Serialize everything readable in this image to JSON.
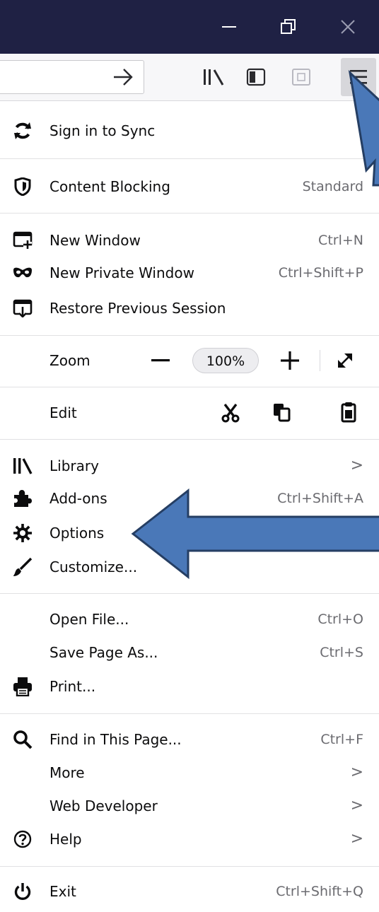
{
  "window": {
    "controls": [
      "minimize-icon",
      "restore-icon",
      "close-icon"
    ]
  },
  "toolbar": {
    "url_forward_icon": "arrow-right-icon",
    "icons": [
      "library-icon",
      "sidebar-icon",
      "pocket-icon",
      "hamburger-menu-icon"
    ]
  },
  "menu": {
    "sync": {
      "label": "Sign in to Sync",
      "icon": "sync-icon"
    },
    "content_blocking": {
      "label": "Content Blocking",
      "value": "Standard",
      "icon": "shield-icon"
    },
    "new_window": {
      "label": "New Window",
      "shortcut": "Ctrl+N",
      "icon": "new-window-icon"
    },
    "new_private_window": {
      "label": "New Private Window",
      "shortcut": "Ctrl+Shift+P",
      "icon": "private-mask-icon"
    },
    "restore_session": {
      "label": "Restore Previous Session",
      "icon": "restore-session-icon"
    },
    "zoom": {
      "label": "Zoom",
      "value": "100%"
    },
    "edit": {
      "label": "Edit"
    },
    "library": {
      "label": "Library",
      "chevron": ">",
      "icon": "library-icon"
    },
    "addons": {
      "label": "Add-ons",
      "shortcut": "Ctrl+Shift+A",
      "icon": "puzzle-icon"
    },
    "options": {
      "label": "Options",
      "icon": "gear-icon"
    },
    "customize": {
      "label": "Customize...",
      "icon": "paintbrush-icon"
    },
    "open_file": {
      "label": "Open File...",
      "shortcut": "Ctrl+O"
    },
    "save_page": {
      "label": "Save Page As...",
      "shortcut": "Ctrl+S"
    },
    "print": {
      "label": "Print...",
      "icon": "printer-icon"
    },
    "find": {
      "label": "Find in This Page...",
      "shortcut": "Ctrl+F",
      "icon": "search-icon"
    },
    "more": {
      "label": "More",
      "chevron": ">"
    },
    "web_developer": {
      "label": "Web Developer",
      "chevron": ">"
    },
    "help": {
      "label": "Help",
      "chevron": ">",
      "icon": "help-icon"
    },
    "exit": {
      "label": "Exit",
      "shortcut": "Ctrl+Shift+Q",
      "icon": "power-icon"
    }
  },
  "colors": {
    "titlebar": "#1f2144",
    "annotation_arrow": "#4a78b8",
    "annotation_outline": "#253e63"
  }
}
